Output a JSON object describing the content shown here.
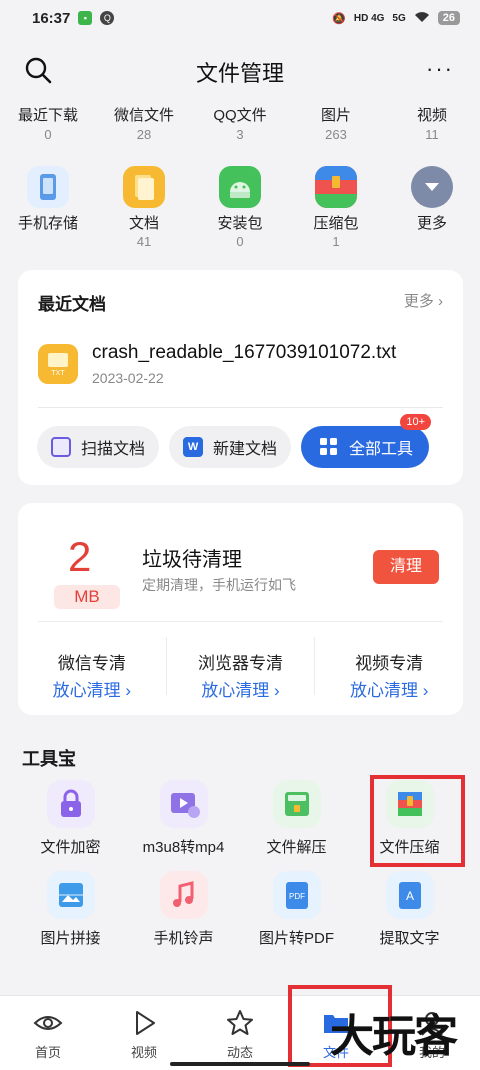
{
  "status": {
    "time": "16:37",
    "net1": "HD 4G",
    "net2": "5G",
    "battery": "26"
  },
  "header": {
    "title": "文件管理",
    "more": "···"
  },
  "categories": [
    {
      "name": "最近下载",
      "count": "0"
    },
    {
      "name": "微信文件",
      "count": "28"
    },
    {
      "name": "QQ文件",
      "count": "3"
    },
    {
      "name": "图片",
      "count": "263"
    },
    {
      "name": "视频",
      "count": "11"
    }
  ],
  "shortcuts": [
    {
      "name": "手机存储",
      "count": "",
      "icon": "phone-storage-icon",
      "color": "#5b9ae6"
    },
    {
      "name": "文档",
      "count": "41",
      "icon": "documents-icon",
      "color": "#f6b931"
    },
    {
      "name": "安装包",
      "count": "0",
      "icon": "android-package-icon",
      "color": "#44c15a"
    },
    {
      "name": "压缩包",
      "count": "1",
      "icon": "archive-icon",
      "color": "#ef5350"
    },
    {
      "name": "更多",
      "count": "",
      "icon": "more-chevron-icon",
      "color": "#7d8aa8"
    }
  ],
  "recent": {
    "title": "最近文档",
    "more": "更多 ›",
    "file": {
      "name": "crash_readable_1677039101072.txt",
      "date": "2023-02-22",
      "type_label": "TXT"
    },
    "buttons": {
      "scan": "扫描文档",
      "new_doc": "新建文档",
      "all_tools": "全部工具",
      "badge": "10+"
    }
  },
  "junk": {
    "size": "2",
    "unit": "MB",
    "title": "垃圾待清理",
    "subtitle": "定期清理，手机运行如飞",
    "clean_btn": "清理",
    "special": [
      {
        "title": "微信专清",
        "link": "放心清理 ›"
      },
      {
        "title": "浏览器专清",
        "link": "放心清理 ›"
      },
      {
        "title": "视频专清",
        "link": "放心清理 ›"
      }
    ]
  },
  "toolbox": {
    "title": "工具宝",
    "items": [
      {
        "name": "文件加密",
        "icon": "lock-icon",
        "bg": "#efeafc",
        "fg": "#8a63e8"
      },
      {
        "name": "m3u8转mp4",
        "icon": "video-convert-icon",
        "bg": "#efeafc",
        "fg": "#8e72e6"
      },
      {
        "name": "文件解压",
        "icon": "unzip-icon",
        "bg": "#e7f6e9",
        "fg": "#4bbf62"
      },
      {
        "name": "文件压缩",
        "icon": "compress-icon",
        "bg": "#e7f6e9",
        "fg": "#ef5350"
      },
      {
        "name": "图片拼接",
        "icon": "image-stitch-icon",
        "bg": "#e6f2fd",
        "fg": "#3d9be9"
      },
      {
        "name": "手机铃声",
        "icon": "ringtone-icon",
        "bg": "#fde9ea",
        "fg": "#f06071"
      },
      {
        "name": "图片转PDF",
        "icon": "image-to-pdf-icon",
        "bg": "#e6f2fd",
        "fg": "#3d8ae9"
      },
      {
        "name": "提取文字",
        "icon": "extract-text-icon",
        "bg": "#e6f2fd",
        "fg": "#3d8ae9"
      }
    ]
  },
  "tabs": [
    {
      "label": "首页",
      "icon": "eye-icon"
    },
    {
      "label": "视频",
      "icon": "play-icon"
    },
    {
      "label": "动态",
      "icon": "star-icon"
    },
    {
      "label": "文件",
      "icon": "folder-icon",
      "active": true
    },
    {
      "label": "我的",
      "icon": "profile-icon"
    }
  ],
  "watermark": "大玩客",
  "accent": "#2a6ae0"
}
